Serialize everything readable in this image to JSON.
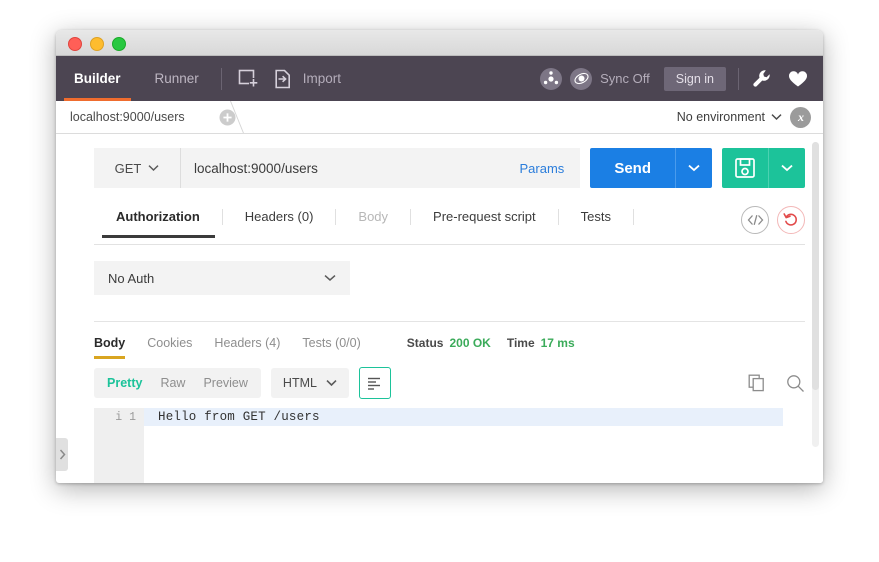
{
  "window": {
    "traffic_lights": [
      "close",
      "minimize",
      "zoom"
    ],
    "colors": {
      "close": "#ff5f57",
      "minimize": "#febc2e",
      "zoom": "#28c840",
      "header_bg": "#4c4552",
      "accent_orange": "#ef6c2e",
      "send_blue": "#1b7fe4",
      "save_teal": "#1cc39a",
      "status_green": "#3bab5a",
      "body_underline": "#d9a520"
    }
  },
  "header": {
    "nav": [
      {
        "label": "Builder",
        "active": true
      },
      {
        "label": "Runner",
        "active": false
      }
    ],
    "new_icon": "new-request-icon",
    "import_icon": "import-icon",
    "import_label": "Import",
    "right": {
      "share_icon": "share-network-icon",
      "sync_icon": "sync-icon",
      "sync_label": "Sync Off",
      "signin_label": "Sign in",
      "wrench_icon": "wrench-icon",
      "heart_icon": "heart-icon"
    }
  },
  "tabstrip": {
    "tabs": [
      {
        "label": "localhost:9000/users",
        "active": true
      }
    ],
    "new_tab_icon": "plus-circle-icon",
    "environment_label": "No environment",
    "environment_caret": "chevron-down-icon",
    "env_quicklook_icon": "environment-quicklook-icon"
  },
  "request": {
    "method": "GET",
    "method_caret": "chevron-down-icon",
    "url": "localhost:9000/users",
    "params_label": "Params",
    "send_label": "Send",
    "send_caret": "chevron-down-icon",
    "save_icon": "save-disk-icon",
    "save_caret": "chevron-down-icon",
    "tabs": [
      {
        "label": "Authorization",
        "active": true,
        "disabled": false
      },
      {
        "label": "Headers (0)",
        "active": false,
        "disabled": false
      },
      {
        "label": "Body",
        "active": false,
        "disabled": true
      },
      {
        "label": "Pre-request script",
        "active": false,
        "disabled": false
      },
      {
        "label": "Tests",
        "active": false,
        "disabled": false
      }
    ],
    "code_icon": "code-brackets-icon",
    "reset_icon": "reset-undo-icon",
    "auth_type": "No Auth",
    "auth_caret": "chevron-down-icon"
  },
  "response": {
    "tabs": [
      {
        "label": "Body",
        "active": true
      },
      {
        "label": "Cookies",
        "active": false
      },
      {
        "label": "Headers (4)",
        "active": false
      },
      {
        "label": "Tests (0/0)",
        "active": false
      }
    ],
    "status_key": "Status",
    "status_value": "200 OK",
    "time_key": "Time",
    "time_value": "17 ms",
    "view_modes": [
      {
        "label": "Pretty",
        "active": true
      },
      {
        "label": "Raw",
        "active": false
      },
      {
        "label": "Preview",
        "active": false
      }
    ],
    "format": "HTML",
    "format_caret": "chevron-down-icon",
    "wrap_icon": "wrap-lines-icon",
    "copy_icon": "copy-icon",
    "search_icon": "search-icon",
    "body_lines": [
      {
        "marker": "i",
        "number": "1",
        "text": "Hello from GET /users"
      }
    ]
  },
  "sidebar": {
    "expand_icon": "chevron-right-icon"
  }
}
